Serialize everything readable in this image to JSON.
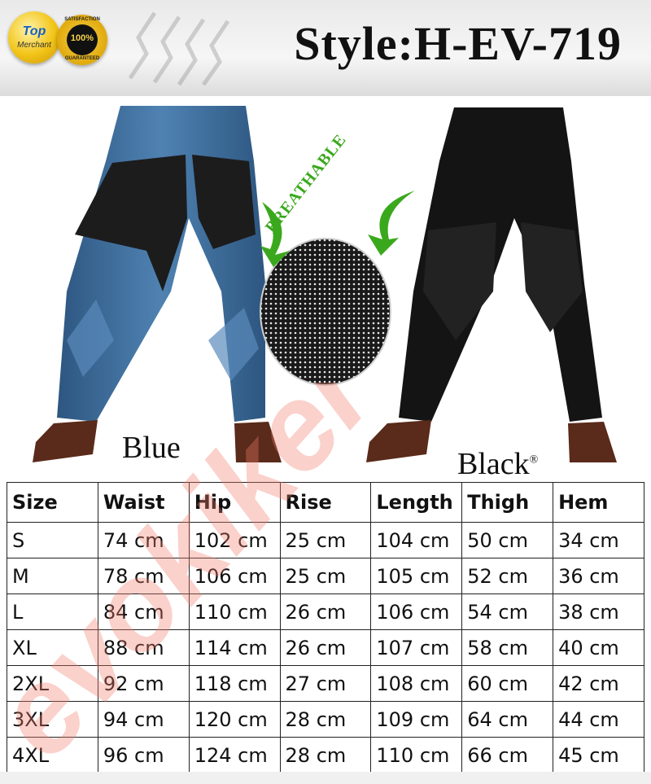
{
  "header": {
    "title": "Style:H-EV-719",
    "badge_top_line1": "Top",
    "badge_top_line2": "Merchant",
    "badge_sat_top": "SATISFACTION",
    "badge_sat_pct": "100%",
    "badge_sat_bottom": "GUARANTEED"
  },
  "product": {
    "variant_blue": "Blue",
    "variant_black": "Black",
    "feature": "BREATHABLE"
  },
  "watermark_text": "evokiker",
  "size_table": {
    "headers": [
      "Size",
      "Waist",
      "Hip",
      "Rise",
      "Length",
      "Thigh",
      "Hem"
    ],
    "rows": [
      [
        "S",
        "74 cm",
        "102 cm",
        "25 cm",
        "104 cm",
        "50 cm",
        "34 cm"
      ],
      [
        "M",
        "78 cm",
        "106 cm",
        "25 cm",
        "105 cm",
        "52 cm",
        "36 cm"
      ],
      [
        "L",
        "84 cm",
        "110 cm",
        "26 cm",
        "106 cm",
        "54 cm",
        "38 cm"
      ],
      [
        "XL",
        "88 cm",
        "114 cm",
        "26 cm",
        "107 cm",
        "58 cm",
        "40 cm"
      ],
      [
        "2XL",
        "92 cm",
        "118 cm",
        "27 cm",
        "108 cm",
        "60 cm",
        "42 cm"
      ],
      [
        "3XL",
        "94 cm",
        "120 cm",
        "28 cm",
        "109 cm",
        "64 cm",
        "44 cm"
      ],
      [
        "4XL",
        "96 cm",
        "124 cm",
        "28 cm",
        "110 cm",
        "66 cm",
        "45 cm"
      ]
    ]
  },
  "colors": {
    "denim_blue": "#3f6f9e",
    "mesh_black": "#1a1a1a",
    "breathable_green": "#3aa81c",
    "boot_brown": "#5a2a1a",
    "watermark": "#f07a6a"
  }
}
